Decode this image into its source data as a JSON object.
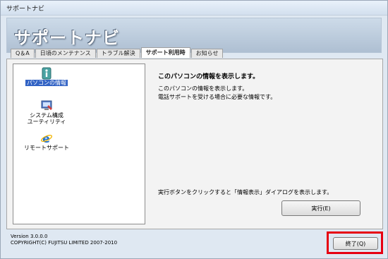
{
  "window": {
    "title": "サポートナビ"
  },
  "header": {
    "title": "サポートナビ"
  },
  "tabs": [
    {
      "label": "Q＆A",
      "active": false
    },
    {
      "label": "日頃のメンテナンス",
      "active": false
    },
    {
      "label": "トラブル解決",
      "active": false
    },
    {
      "label": "サポート利用時",
      "active": true
    },
    {
      "label": "お知らせ",
      "active": false
    }
  ],
  "left_items": [
    {
      "label": "パソコンの情報",
      "icon": "info-icon",
      "selected": true
    },
    {
      "label": "システム構成\nユーティリティ",
      "icon": "system-config-icon",
      "selected": false
    },
    {
      "label": "リモートサポート",
      "icon": "internet-explorer-icon",
      "selected": false
    }
  ],
  "detail": {
    "title": "このパソコンの情報を表示します。",
    "desc_line1": "このパソコンの情報を表示します。",
    "desc_line2": "電話サポートを受ける場合に必要な情報です。",
    "exec_note": "実行ボタンをクリックすると「情報表示」ダイアログを表示します。",
    "exec_button": "実行(E)"
  },
  "footer": {
    "version": "Version 3.0.0.0",
    "copyright": "COPYRIGHT(C) FUJITSU LIMITED 2007-2010"
  },
  "close_button": {
    "label": "終了(Q)"
  },
  "colors": {
    "highlight_box": "#e60012",
    "selection": "#3162c4"
  }
}
